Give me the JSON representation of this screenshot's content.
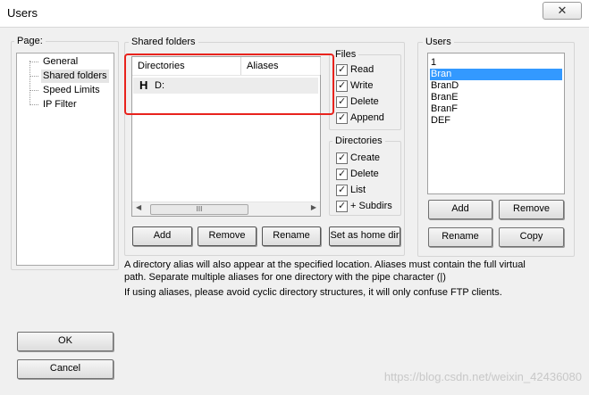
{
  "window": {
    "title": "Users",
    "subtitle": "",
    "close_label": "✕"
  },
  "page_group": {
    "label": "Page:",
    "items": [
      "General",
      "Shared folders",
      "Speed Limits",
      "IP Filter"
    ],
    "selected": "Shared folders"
  },
  "shared": {
    "label": "Shared folders",
    "columns": [
      "Directories",
      "Aliases"
    ],
    "rows": [
      {
        "flag": "H",
        "path": "D:",
        "alias": ""
      }
    ],
    "scroll_thumb": "III",
    "buttons": {
      "add": "Add",
      "remove": "Remove",
      "rename": "Rename",
      "home": "Set as home dir"
    }
  },
  "files": {
    "label": "Files",
    "options": [
      {
        "label": "Read",
        "checked": true
      },
      {
        "label": "Write",
        "checked": true
      },
      {
        "label": "Delete",
        "checked": true
      },
      {
        "label": "Append",
        "checked": true
      }
    ]
  },
  "directories": {
    "label": "Directories",
    "options": [
      {
        "label": "Create",
        "checked": true
      },
      {
        "label": "Delete",
        "checked": true
      },
      {
        "label": "List",
        "checked": true
      },
      {
        "label": "+ Subdirs",
        "checked": true
      }
    ]
  },
  "users": {
    "label": "Users",
    "items": [
      "1",
      "Bran",
      "BranD",
      "BranE",
      "BranF",
      "DEF"
    ],
    "selected": "Bran",
    "buttons": {
      "add": "Add",
      "remove": "Remove",
      "rename": "Rename",
      "copy": "Copy"
    }
  },
  "info": {
    "line1": "A directory alias will also appear at the specified location. Aliases must contain the full virtual",
    "line2": "path. Separate multiple aliases for one directory with the pipe character (|)",
    "line3": "If using aliases, please avoid cyclic directory structures, it will only confuse FTP clients."
  },
  "footer": {
    "ok": "OK",
    "cancel": "Cancel"
  },
  "watermark": "https://blog.csdn.net/weixin_42436080",
  "colors": {
    "selection": "#3399ff",
    "highlight_box": "#e8231d"
  }
}
